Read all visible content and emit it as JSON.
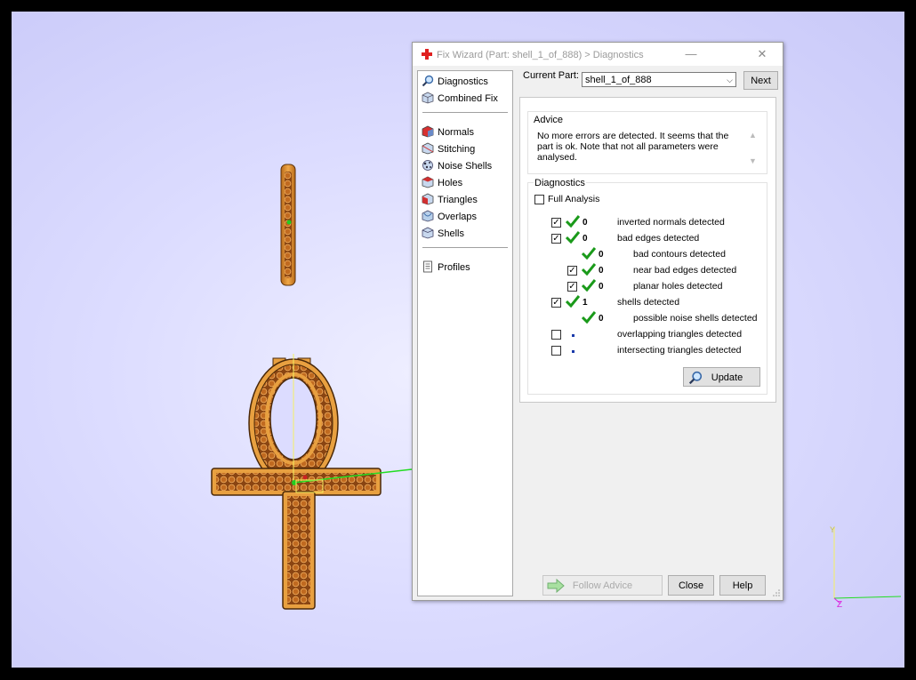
{
  "window": {
    "title": "Fix Wizard (Part: shell_1_of_888) > Diagnostics",
    "minimize_label": "—",
    "close_label": "✕"
  },
  "nav": {
    "items": [
      {
        "label": "Diagnostics",
        "icon": "magnifier-icon"
      },
      {
        "label": "Combined Fix",
        "icon": "cube-icon"
      },
      {
        "label": "Normals",
        "icon": "normals-icon"
      },
      {
        "label": "Stitching",
        "icon": "stitching-icon"
      },
      {
        "label": "Noise Shells",
        "icon": "noise-shells-icon"
      },
      {
        "label": "Holes",
        "icon": "holes-icon"
      },
      {
        "label": "Triangles",
        "icon": "triangles-icon"
      },
      {
        "label": "Overlaps",
        "icon": "overlaps-icon"
      },
      {
        "label": "Shells",
        "icon": "shells-icon"
      },
      {
        "label": "Profiles",
        "icon": "document-icon"
      }
    ]
  },
  "header": {
    "current_part_label": "Current Part:",
    "current_part_value": "shell_1_of_888",
    "next_label": "Next"
  },
  "advice": {
    "title": "Advice",
    "text": "No more errors are detected. It seems that the part is ok. Note that not all parameters were analysed."
  },
  "diagnostics": {
    "title": "Diagnostics",
    "full_analysis_label": "Full Analysis",
    "full_analysis_checked": false,
    "rows": [
      {
        "label": "inverted normals detected",
        "count": "0",
        "checked": true,
        "status": "ok"
      },
      {
        "label": "bad edges detected",
        "count": "0",
        "checked": true,
        "status": "ok"
      },
      {
        "label": "bad contours detected",
        "count": "0",
        "status": "ok"
      },
      {
        "label": "near bad edges detected",
        "count": "0",
        "checked": true,
        "status": "ok"
      },
      {
        "label": "planar holes detected",
        "count": "0",
        "checked": true,
        "status": "ok"
      },
      {
        "label": "shells detected",
        "count": "1",
        "checked": true,
        "status": "ok"
      },
      {
        "label": "possible noise shells detected",
        "count": "0",
        "status": "ok"
      },
      {
        "label": "overlapping triangles detected",
        "checked": false,
        "status": "not-analysed"
      },
      {
        "label": "intersecting triangles detected",
        "checked": false,
        "status": "not-analysed"
      }
    ],
    "update_label": "Update"
  },
  "footer": {
    "follow_advice_label": "Follow Advice",
    "close_label": "Close",
    "help_label": "Help"
  },
  "axes": {
    "y_label": "Y",
    "z_label": "Z"
  },
  "colors": {
    "accent_green": "#1a9a1a",
    "model_gold": "#d98a2b",
    "stone_brown": "#8a4a14",
    "viewport_bg": "#dcdcff"
  }
}
